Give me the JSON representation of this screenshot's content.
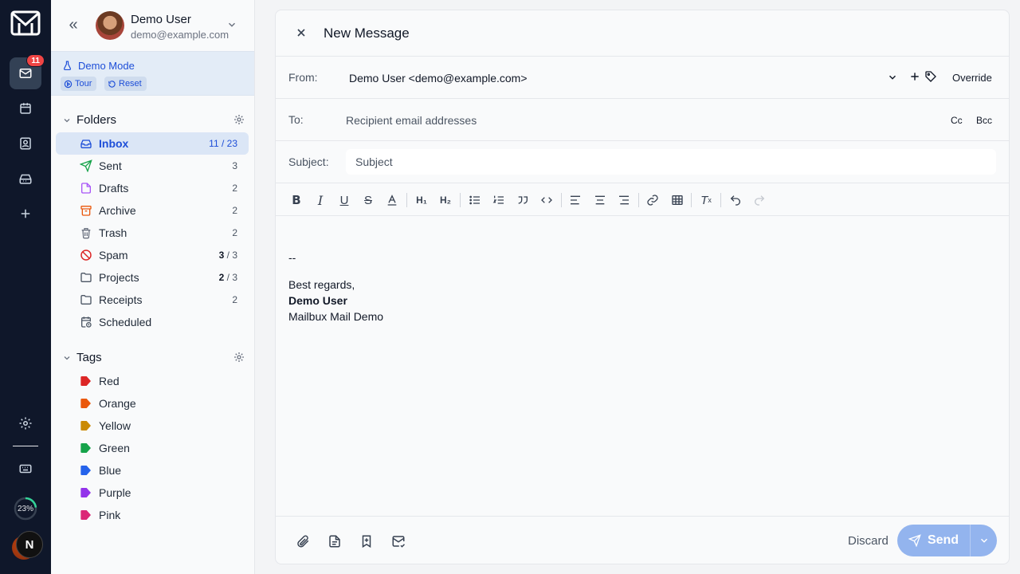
{
  "rail": {
    "mail_badge": "11",
    "storage_percent_text": "23%",
    "storage_fraction": 0.23,
    "n_button": "N",
    "icons": [
      "mail-logo-icon",
      "mail-icon",
      "calendar-icon",
      "contacts-icon",
      "inbox-tray-icon",
      "plus-icon",
      "gear-icon",
      "keyboard-icon"
    ]
  },
  "user": {
    "name": "Demo User",
    "email": "demo@example.com"
  },
  "demo": {
    "title": "Demo Mode",
    "tour": "Tour",
    "reset": "Reset"
  },
  "folders": {
    "title": "Folders",
    "items": [
      {
        "label": "Inbox",
        "unread": "11",
        "sep": " / ",
        "total": "23",
        "active": true
      },
      {
        "label": "Sent",
        "total": "3"
      },
      {
        "label": "Drafts",
        "total": "2"
      },
      {
        "label": "Archive",
        "total": "2"
      },
      {
        "label": "Trash",
        "total": "2"
      },
      {
        "label": "Spam",
        "unread": "3",
        "sep": " / ",
        "total": "3"
      },
      {
        "label": "Projects",
        "unread": "2",
        "sep": " / ",
        "total": "3"
      },
      {
        "label": "Receipts",
        "total": "2"
      },
      {
        "label": "Scheduled",
        "total": ""
      }
    ]
  },
  "tags": {
    "title": "Tags",
    "items": [
      {
        "label": "Red",
        "color": "#dc2626"
      },
      {
        "label": "Orange",
        "color": "#ea580c"
      },
      {
        "label": "Yellow",
        "color": "#ca8a04"
      },
      {
        "label": "Green",
        "color": "#16a34a"
      },
      {
        "label": "Blue",
        "color": "#2563eb"
      },
      {
        "label": "Purple",
        "color": "#9333ea"
      },
      {
        "label": "Pink",
        "color": "#db2777"
      }
    ]
  },
  "composer": {
    "title": "New Message",
    "from_label": "From:",
    "from_value": "Demo User <demo@example.com>",
    "override": "Override",
    "to_label": "To:",
    "to_placeholder": "Recipient email addresses",
    "cc": "Cc",
    "bcc": "Bcc",
    "subject_label": "Subject:",
    "subject_placeholder": "Subject",
    "body": {
      "sig_sep": "--",
      "regards": "Best regards,",
      "name": "Demo User",
      "org": "Mailbux Mail Demo"
    },
    "discard": "Discard",
    "send": "Send"
  }
}
